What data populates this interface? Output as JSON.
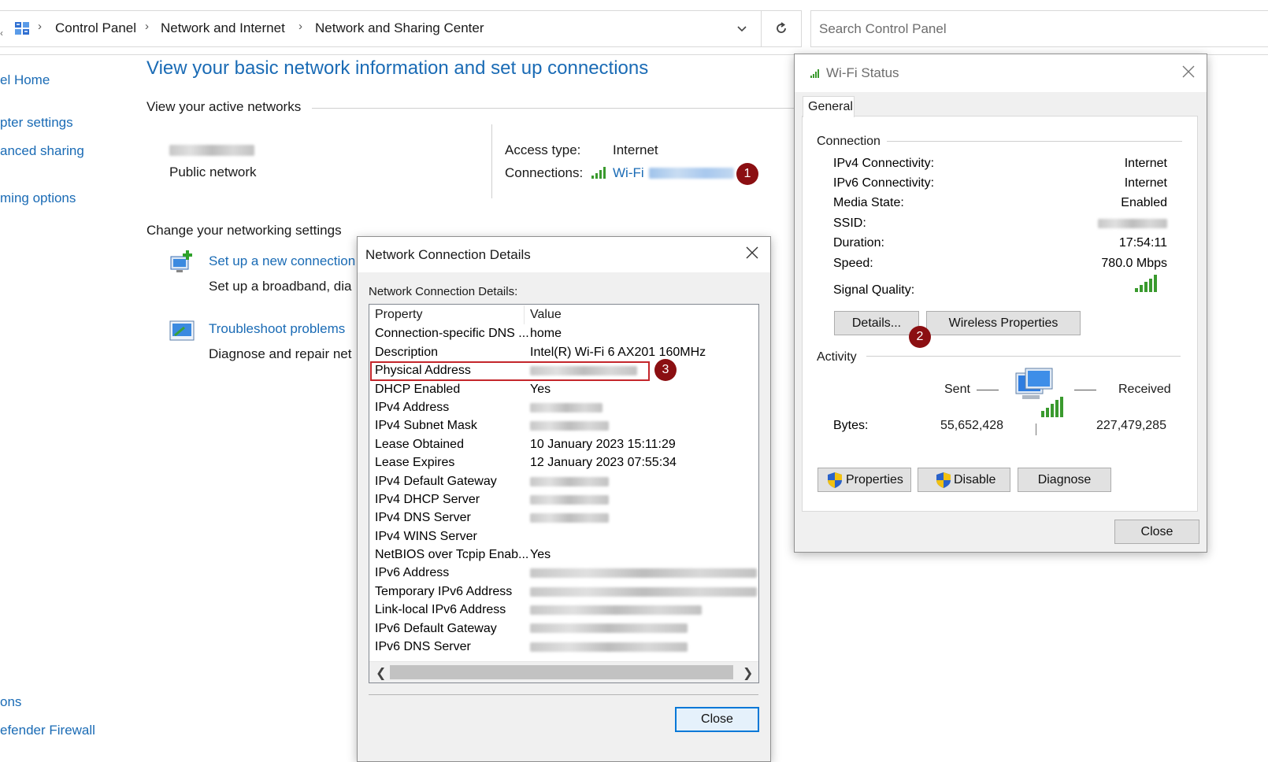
{
  "breadcrumb": {
    "items": [
      "Control Panel",
      "Network and Internet",
      "Network and Sharing Center"
    ]
  },
  "search": {
    "placeholder": "Search Control Panel"
  },
  "sidebar": {
    "items": [
      "el Home",
      "pter settings",
      "anced sharing",
      "ming options",
      "ons",
      "efender Firewall"
    ]
  },
  "main": {
    "title": "View your basic network information and set up connections",
    "active_networks_label": "View your active networks",
    "network_type": "Public network",
    "access_type_label": "Access type:",
    "access_type_value": "Internet",
    "connections_label": "Connections:",
    "connection_name": "Wi-Fi",
    "change_settings_label": "Change your networking settings",
    "setup_link": "Set up a new connection",
    "setup_desc": "Set up a broadband, dia",
    "troubleshoot_link": "Troubleshoot problems",
    "troubleshoot_desc": "Diagnose and repair net"
  },
  "badges": {
    "b1": "1",
    "b2": "2",
    "b3": "3"
  },
  "details_dialog": {
    "title": "Network Connection Details",
    "group_label": "Network Connection Details:",
    "col_property": "Property",
    "col_value": "Value",
    "rows": [
      {
        "p": "Connection-specific DNS ...",
        "v": "home"
      },
      {
        "p": "Description",
        "v": "Intel(R) Wi-Fi 6 AX201 160MHz"
      },
      {
        "p": "Physical Address",
        "v": ""
      },
      {
        "p": "DHCP Enabled",
        "v": "Yes"
      },
      {
        "p": "IPv4 Address",
        "v": ""
      },
      {
        "p": "IPv4 Subnet Mask",
        "v": ""
      },
      {
        "p": "Lease Obtained",
        "v": "10 January 2023 15:11:29"
      },
      {
        "p": "Lease Expires",
        "v": "12 January 2023 07:55:34"
      },
      {
        "p": "IPv4 Default Gateway",
        "v": ""
      },
      {
        "p": "IPv4 DHCP Server",
        "v": ""
      },
      {
        "p": "IPv4 DNS Server",
        "v": ""
      },
      {
        "p": "IPv4 WINS Server",
        "v": ""
      },
      {
        "p": "NetBIOS over Tcpip Enab...",
        "v": "Yes"
      },
      {
        "p": "IPv6 Address",
        "v": ""
      },
      {
        "p": "Temporary IPv6 Address",
        "v": ""
      },
      {
        "p": "Link-local IPv6 Address",
        "v": ""
      },
      {
        "p": "IPv6 Default Gateway",
        "v": ""
      },
      {
        "p": "IPv6 DNS Server",
        "v": ""
      }
    ],
    "close_label": "Close"
  },
  "wifi_status": {
    "title": "Wi-Fi Status",
    "tab": "General",
    "connection_label": "Connection",
    "ipv4_label": "IPv4 Connectivity:",
    "ipv4_value": "Internet",
    "ipv6_label": "IPv6 Connectivity:",
    "ipv6_value": "Internet",
    "media_label": "Media State:",
    "media_value": "Enabled",
    "ssid_label": "SSID:",
    "duration_label": "Duration:",
    "duration_value": "17:54:11",
    "speed_label": "Speed:",
    "speed_value": "780.0 Mbps",
    "signal_label": "Signal Quality:",
    "details_button": "Details...",
    "wireless_props_button": "Wireless Properties",
    "activity_label": "Activity",
    "sent_label": "Sent",
    "received_label": "Received",
    "bytes_label": "Bytes:",
    "bytes_sent": "55,652,428",
    "bytes_received": "227,479,285",
    "properties_button": "Properties",
    "disable_button": "Disable",
    "diagnose_button": "Diagnose",
    "close_button": "Close"
  },
  "colors": {
    "link": "#1a6bb5",
    "badge": "#8b0f12",
    "highlight": "#c4262b",
    "signal": "#3a9a2e"
  }
}
